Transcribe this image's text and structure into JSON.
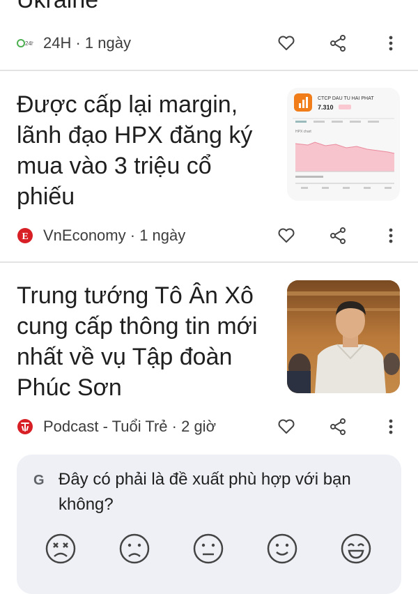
{
  "articles": [
    {
      "title_fragment": "Ukraine",
      "source": "24H",
      "time": "1 ngày",
      "logo_text": "24h"
    },
    {
      "title": "Được cấp lại margin, lãnh đạo HPX đăng ký mua vào 3 triệu cổ phiếu",
      "source": "VnEconomy",
      "time": "1 ngày",
      "logo_text": "E",
      "thumb": {
        "company": "CTCP DAU TU HAI PHAT",
        "price": "7.310",
        "chart_label": "HPX chart"
      }
    },
    {
      "title": "Trung tướng Tô Ân Xô cung cấp thông tin mới nhất về vụ Tập đoàn Phúc Sơn",
      "source": "Podcast - Tuổi Trẻ",
      "time": "2 giờ"
    }
  ],
  "separator": " · ",
  "feedback": {
    "icon": "G",
    "question": "Đây có phải là đề xuất phù hợp với bạn không?",
    "faces": [
      "very-dissatisfied-icon",
      "dissatisfied-icon",
      "neutral-icon",
      "satisfied-icon",
      "very-satisfied-icon"
    ]
  },
  "icons": {
    "like": "heart-outline-icon",
    "share": "share-icon",
    "more": "more-vert-icon"
  },
  "colors": {
    "vneconomy_red": "#d81f26",
    "tuoitre_red": "#d81f26",
    "orange_logo": "#f07d1a",
    "chart_pink": "#f4aab8",
    "card_bg": "#eef0f5"
  }
}
